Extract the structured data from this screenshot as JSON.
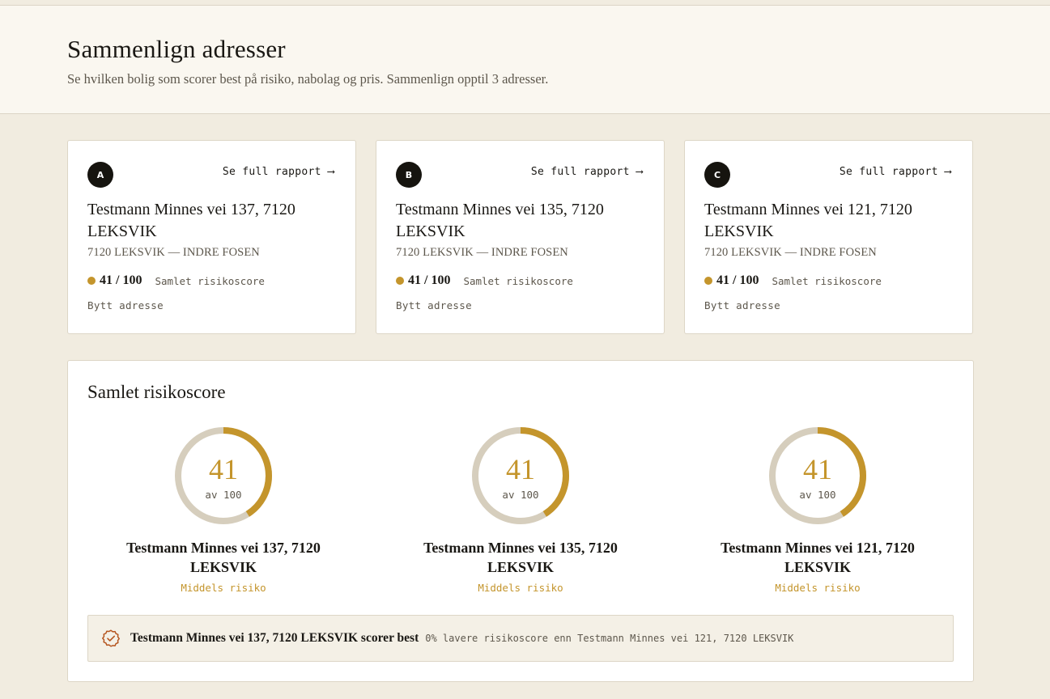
{
  "header": {
    "title": "Sammenlign adresser",
    "subtitle": "Se hvilken bolig som scorer best på risiko, nabolag og pris. Sammenlign opptil 3 adresser."
  },
  "cards": [
    {
      "badge": "A",
      "report_link": "Se full rapport ⟶",
      "address": "Testmann Minnes vei 137, 7120 LEKSVIK",
      "region": "7120 LEKSVIK — INDRE FOSEN",
      "score": "41 / 100",
      "score_label": "Samlet risikoscore",
      "change_label": "Bytt adresse"
    },
    {
      "badge": "B",
      "report_link": "Se full rapport ⟶",
      "address": "Testmann Minnes vei 135, 7120 LEKSVIK",
      "region": "7120 LEKSVIK — INDRE FOSEN",
      "score": "41 / 100",
      "score_label": "Samlet risikoscore",
      "change_label": "Bytt adresse"
    },
    {
      "badge": "C",
      "report_link": "Se full rapport ⟶",
      "address": "Testmann Minnes vei 121, 7120 LEKSVIK",
      "region": "7120 LEKSVIK — INDRE FOSEN",
      "score": "41 / 100",
      "score_label": "Samlet risikoscore",
      "change_label": "Bytt adresse"
    }
  ],
  "overall": {
    "title": "Samlet risikoscore",
    "gauges": [
      {
        "value": 41,
        "value_text": "41",
        "of_text": "av 100",
        "address": "Testmann Minnes vei 137, 7120 LEKSVIK",
        "risk": "Middels risiko"
      },
      {
        "value": 41,
        "value_text": "41",
        "of_text": "av 100",
        "address": "Testmann Minnes vei 135, 7120 LEKSVIK",
        "risk": "Middels risiko"
      },
      {
        "value": 41,
        "value_text": "41",
        "of_text": "av 100",
        "address": "Testmann Minnes vei 121, 7120 LEKSVIK",
        "risk": "Middels risiko"
      }
    ],
    "winner": {
      "icon": "check-badge-icon",
      "text": "Testmann Minnes vei 137, 7120 LEKSVIK scorer best",
      "sub": "0% lavere risikoscore enn Testmann Minnes vei 121, 7120 LEKSVIK"
    }
  },
  "colors": {
    "accent": "#c4952c",
    "track": "#d6cebd",
    "badge": "#16140f",
    "background": "#f1ece0"
  }
}
